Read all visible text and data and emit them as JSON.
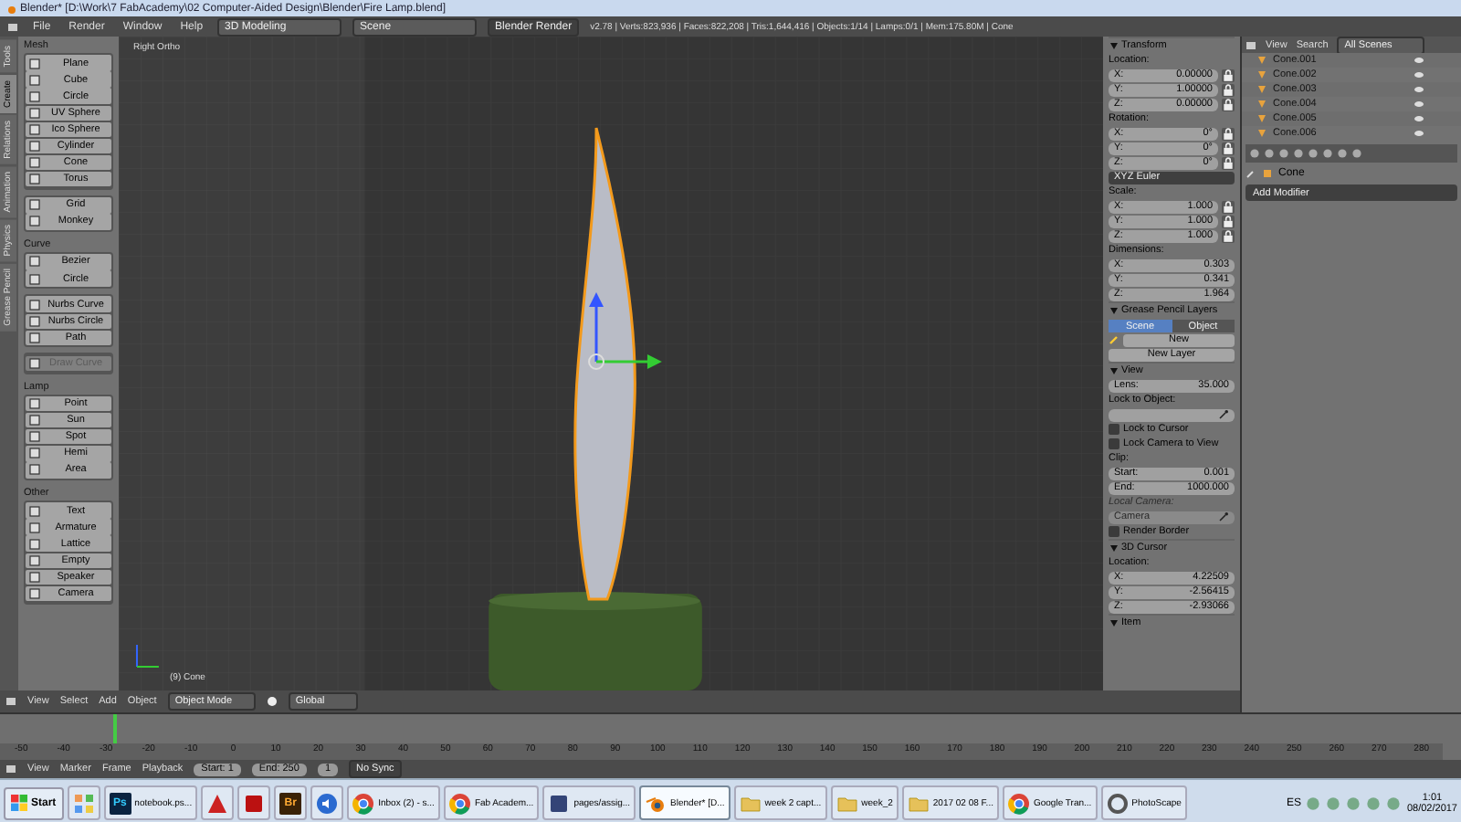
{
  "window": {
    "title": "Blender* [D:\\Work\\7 FabAcademy\\02 Computer-Aided Design\\Blender\\Fire Lamp.blend]"
  },
  "menu_bar": {
    "menus": [
      "File",
      "Render",
      "Window",
      "Help"
    ],
    "layout": "3D Modeling",
    "scene": "Scene",
    "engine": "Blender Render",
    "stats": "v2.78 | Verts:823,936 | Faces:822,208 | Tris:1,644,416 | Objects:1/14 | Lamps:0/1 | Mem:175.80M | Cone"
  },
  "tool_tabs": [
    {
      "label": "Tools",
      "selected": false
    },
    {
      "label": "Create",
      "selected": true
    },
    {
      "label": "Relations",
      "selected": false
    },
    {
      "label": "Animation",
      "selected": false
    },
    {
      "label": "Physics",
      "selected": false
    },
    {
      "label": "Grease Pencil",
      "selected": false
    }
  ],
  "tool_shelf": {
    "sections": [
      {
        "title": "Mesh",
        "groups": [
          [
            {
              "label": "Plane",
              "disabled": false
            },
            {
              "label": "Cube",
              "disabled": false
            },
            {
              "label": "Circle",
              "disabled": false
            },
            {
              "label": "UV Sphere",
              "disabled": false
            },
            {
              "label": "Ico Sphere",
              "disabled": false
            },
            {
              "label": "Cylinder",
              "disabled": false
            },
            {
              "label": "Cone",
              "disabled": false
            },
            {
              "label": "Torus",
              "disabled": false
            }
          ],
          [
            {
              "label": "Grid",
              "disabled": false
            },
            {
              "label": "Monkey",
              "disabled": false
            }
          ]
        ]
      },
      {
        "title": "Curve",
        "groups": [
          [
            {
              "label": "Bezier",
              "disabled": false
            },
            {
              "label": "Circle",
              "disabled": false
            }
          ],
          [
            {
              "label": "Nurbs Curve",
              "disabled": false
            },
            {
              "label": "Nurbs Circle",
              "disabled": false
            },
            {
              "label": "Path",
              "disabled": false
            }
          ],
          [
            {
              "label": "Draw Curve",
              "disabled": true
            }
          ]
        ]
      },
      {
        "title": "Lamp",
        "groups": [
          [
            {
              "label": "Point",
              "disabled": false
            },
            {
              "label": "Sun",
              "disabled": false
            },
            {
              "label": "Spot",
              "disabled": false
            },
            {
              "label": "Hemi",
              "disabled": false
            },
            {
              "label": "Area",
              "disabled": false
            }
          ]
        ]
      },
      {
        "title": "Other",
        "groups": [
          [
            {
              "label": "Text",
              "disabled": false
            },
            {
              "label": "Armature",
              "disabled": false
            },
            {
              "label": "Lattice",
              "disabled": false
            },
            {
              "label": "Empty",
              "disabled": false
            },
            {
              "label": "Speaker",
              "disabled": false
            },
            {
              "label": "Camera",
              "disabled": false
            }
          ]
        ]
      }
    ]
  },
  "viewport": {
    "view_name": "Right Ortho",
    "object_label": "(9) Cone"
  },
  "properties": {
    "sections": [
      {
        "title": "Transform",
        "rows": [
          {
            "kind": "label",
            "text": "Location:",
            "disabled": false
          },
          {
            "kind": "lock_field",
            "label": "X:",
            "value": "0.00000"
          },
          {
            "kind": "lock_field",
            "label": "Y:",
            "value": "1.00000"
          },
          {
            "kind": "lock_field",
            "label": "Z:",
            "value": "0.00000"
          },
          {
            "kind": "label",
            "text": "Rotation:",
            "disabled": false
          },
          {
            "kind": "lock_field",
            "label": "X:",
            "value": "0°"
          },
          {
            "kind": "lock_field",
            "label": "Y:",
            "value": "0°"
          },
          {
            "kind": "lock_field",
            "label": "Z:",
            "value": "0°"
          },
          {
            "kind": "dropdown",
            "value": "XYZ Euler"
          },
          {
            "kind": "label",
            "text": "Scale:",
            "disabled": false
          },
          {
            "kind": "lock_field",
            "label": "X:",
            "value": "1.000"
          },
          {
            "kind": "lock_field",
            "label": "Y:",
            "value": "1.000"
          },
          {
            "kind": "lock_field",
            "label": "Z:",
            "value": "1.000"
          },
          {
            "kind": "label",
            "text": "Dimensions:",
            "disabled": false
          },
          {
            "kind": "field",
            "label": "X:",
            "value": "0.303"
          },
          {
            "kind": "field",
            "label": "Y:",
            "value": "0.341"
          },
          {
            "kind": "field",
            "label": "Z:",
            "value": "1.964"
          }
        ]
      },
      {
        "title": "Grease Pencil Layers",
        "rows": [
          {
            "kind": "tabs",
            "items": [
              {
                "label": "Scene",
                "selected": true
              },
              {
                "label": "Object",
                "selected": false
              }
            ]
          },
          {
            "kind": "new_row",
            "label": "New"
          },
          {
            "kind": "button",
            "label": "New Layer"
          }
        ]
      },
      {
        "title": "View",
        "rows": [
          {
            "kind": "field",
            "label": "Lens:",
            "value": "35.000"
          },
          {
            "kind": "label",
            "text": "Lock to Object:",
            "disabled": false
          },
          {
            "kind": "picker",
            "disabled": false
          },
          {
            "kind": "checkbox",
            "label": "Lock to Cursor",
            "checked": false
          },
          {
            "kind": "checkbox",
            "label": "Lock Camera to View",
            "checked": false
          },
          {
            "kind": "label",
            "text": "Clip:",
            "disabled": false
          },
          {
            "kind": "field",
            "label": "Start:",
            "value": "0.001"
          },
          {
            "kind": "field",
            "label": "End:",
            "value": "1000.000"
          },
          {
            "kind": "label",
            "text": "Local Camera:",
            "disabled": true
          },
          {
            "kind": "picker",
            "value": "Camera",
            "disabled": true
          },
          {
            "kind": "checkbox",
            "label": "Render Border",
            "checked": false
          }
        ]
      },
      {
        "title": "3D Cursor",
        "rows": [
          {
            "kind": "label",
            "text": "Location:",
            "disabled": false
          },
          {
            "kind": "field",
            "label": "X:",
            "value": "4.22509"
          },
          {
            "kind": "field",
            "label": "Y:",
            "value": "-2.56415"
          },
          {
            "kind": "field",
            "label": "Z:",
            "value": "-2.93066"
          }
        ]
      },
      {
        "title": "Item"
      }
    ]
  },
  "viewport_header": {
    "menus": [
      "View",
      "Select",
      "Add",
      "Object"
    ],
    "mode": "Object Mode",
    "orientation": "Global"
  },
  "outliner": {
    "menus": [
      "View",
      "Search"
    ],
    "filter": "All Scenes",
    "rows": [
      {
        "name": "Cone.001"
      },
      {
        "name": "Cone.002"
      },
      {
        "name": "Cone.003"
      },
      {
        "name": "Cone.004"
      },
      {
        "name": "Cone.005"
      },
      {
        "name": "Cone.006"
      }
    ]
  },
  "modifiers": {
    "object": "Cone",
    "button": "Add Modifier"
  },
  "timeline": {
    "ticks": [
      "-50",
      "-40",
      "-30",
      "-20",
      "-10",
      "0",
      "10",
      "20",
      "30",
      "40",
      "50",
      "60",
      "70",
      "80",
      "90",
      "100",
      "110",
      "120",
      "130",
      "140",
      "150",
      "160",
      "170",
      "180",
      "190",
      "200",
      "210",
      "220",
      "230",
      "240",
      "250",
      "260",
      "270",
      "280"
    ]
  },
  "timeline_header": {
    "menus": [
      "View",
      "Marker",
      "Frame",
      "Playback"
    ],
    "start": "Start: 1",
    "end": "End: 250",
    "current": "1",
    "sync": "No Sync"
  },
  "taskbar": {
    "start": "Start",
    "items": [
      {
        "kind": "grid",
        "selected": false
      },
      {
        "kind": "ps",
        "glyph": "Ps",
        "label": "notebook.ps...",
        "selected": false
      },
      {
        "kind": "autodesk",
        "selected": false
      },
      {
        "kind": "acrobat",
        "selected": false
      },
      {
        "kind": "br",
        "glyph": "Br",
        "selected": false
      },
      {
        "kind": "sound",
        "selected": false
      },
      {
        "kind": "chrome",
        "label": "Inbox (2) - s...",
        "selected": false
      },
      {
        "kind": "chrome",
        "label": "Fab Academ...",
        "selected": false
      },
      {
        "kind": "box",
        "label": "pages/assig...",
        "selected": false
      },
      {
        "kind": "blender",
        "label": "Blender* [D...",
        "selected": true
      },
      {
        "kind": "folder",
        "label": "week 2 capt...",
        "selected": false
      },
      {
        "kind": "folder",
        "label": "week_2",
        "selected": false
      },
      {
        "kind": "folder",
        "label": "2017 02 08 F...",
        "selected": false
      },
      {
        "kind": "chrome",
        "label": "Google Tran...",
        "selected": false
      },
      {
        "kind": "photoscape",
        "label": "PhotoScape",
        "selected": false
      }
    ],
    "language": "ES",
    "time": "1:01",
    "date": "08/02/2017"
  }
}
